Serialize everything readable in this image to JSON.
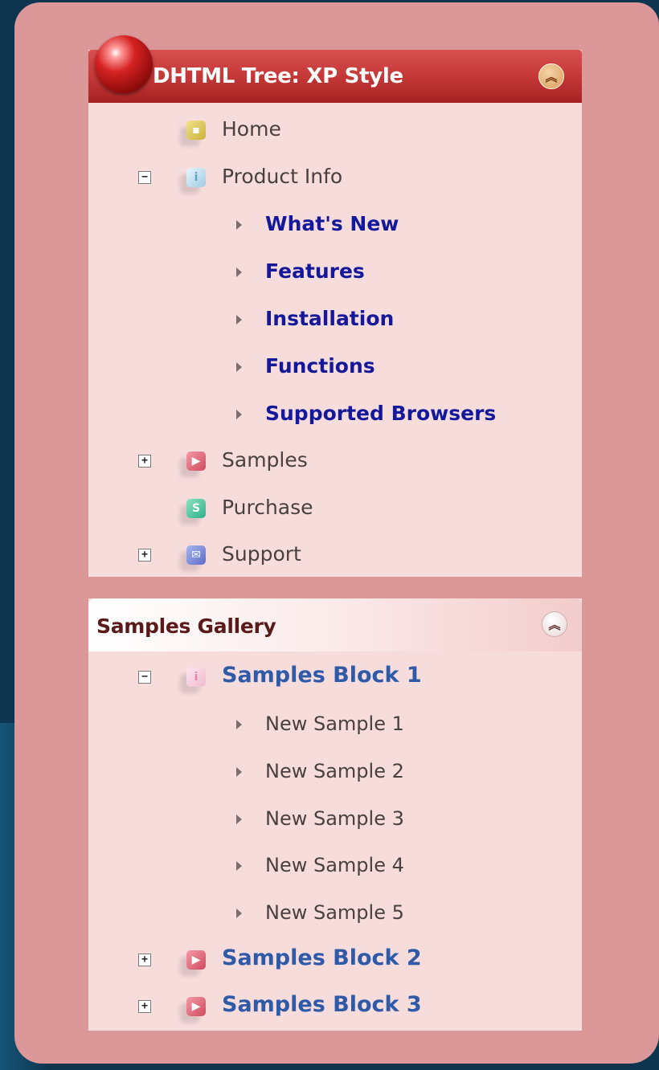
{
  "panel1": {
    "title": "DHTML Tree: XP Style",
    "collapse_icon": "double-chevron-up-icon",
    "items": [
      {
        "label": "Home",
        "icon": "home-icon"
      },
      {
        "label": "Product Info",
        "icon": "info-icon",
        "expanded": true,
        "children": [
          "What's New",
          "Features",
          "Installation",
          "Functions",
          "Supported Browsers"
        ]
      },
      {
        "label": "Samples",
        "icon": "play-icon",
        "expanded": false
      },
      {
        "label": "Purchase",
        "icon": "dollar-icon"
      },
      {
        "label": "Support",
        "icon": "mail-icon",
        "expanded": false
      }
    ]
  },
  "panel2": {
    "title": "Samples Gallery",
    "collapse_icon": "double-chevron-up-icon",
    "items": [
      {
        "label": "Samples Block 1",
        "icon": "info-icon",
        "expanded": true,
        "children": [
          "New Sample 1",
          "New Sample 2",
          "New Sample 3",
          "New Sample 4",
          "New Sample 5"
        ]
      },
      {
        "label": "Samples Block 2",
        "icon": "play-icon",
        "expanded": false
      },
      {
        "label": "Samples Block 3",
        "icon": "play-icon",
        "expanded": false
      }
    ]
  },
  "colors": {
    "frame": "#dc9898",
    "panel_bg": "#f7dcdc",
    "header_red": "#c83a3a",
    "link_blue": "#14189a",
    "block_blue": "#2f5aa8"
  }
}
